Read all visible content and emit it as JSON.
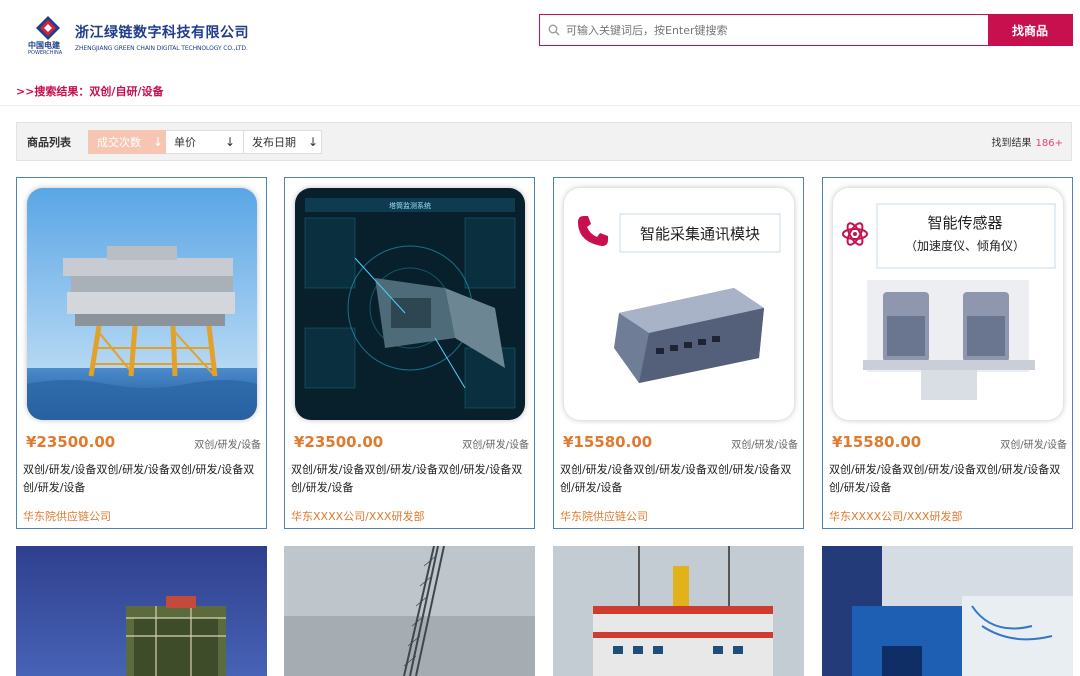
{
  "header": {
    "logo_cn": "中国电建",
    "logo_en": "POWERCHINA",
    "company_cn": "浙江绿链数字科技有限公司",
    "company_en": "ZHENGJIANG GREEN CHAIN DIGITAL TECHNOLOGY CO.,LTD."
  },
  "search": {
    "placeholder": "可输入关键词后，按Enter键搜索",
    "button": "找商品"
  },
  "breadcrumb": ">>搜索结果：双创/自研/设备",
  "filter": {
    "title": "商品列表",
    "sorts": [
      {
        "label": "成交次数",
        "arrow": "↓",
        "active": true
      },
      {
        "label": "单价",
        "arrow": "↓",
        "active": false
      },
      {
        "label": "发布日期",
        "arrow": "↓",
        "active": false
      }
    ],
    "result_label": "找到结果",
    "result_count": "186+"
  },
  "products": [
    {
      "price": "¥23500.00",
      "tag": "双创/研发/设备",
      "desc": "双创/研发/设备双创/研发/设备双创/研发/设备双创/研发/设备",
      "company": "华东院供应链公司"
    },
    {
      "price": "¥23500.00",
      "tag": "双创/研发/设备",
      "desc": "双创/研发/设备双创/研发/设备双创/研发/设备双创/研发/设备",
      "company": "华东XXXX公司/XXX研发部"
    },
    {
      "price": "¥15580.00",
      "tag": "双创/研发/设备",
      "desc": "双创/研发/设备双创/研发/设备双创/研发/设备双创/研发/设备",
      "company": "华东院供应链公司",
      "image_title": "智能采集通讯模块"
    },
    {
      "price": "¥15580.00",
      "tag": "双创/研发/设备",
      "desc": "双创/研发/设备双创/研发/设备双创/研发/设备双创/研发/设备",
      "company": "华东XXXX公司/XXX研发部",
      "image_title": "智能传感器",
      "image_subtitle": "（加速度仪、倾角仪）"
    }
  ],
  "monitor_title": "塔筒监测系统",
  "colors": {
    "brand": "#c8104f",
    "price": "#e07a2e",
    "border": "#4d84b8",
    "logo_blue": "#1f3d8a"
  }
}
